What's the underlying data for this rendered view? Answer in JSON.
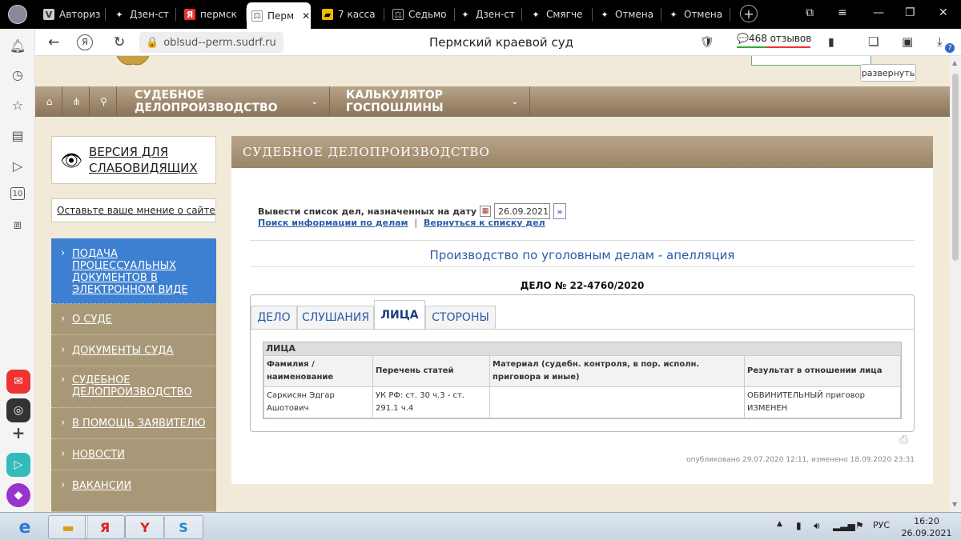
{
  "browser": {
    "tabs": [
      {
        "label": "Авториз",
        "icon": "vk"
      },
      {
        "label": "Дзен-ст",
        "icon": "dzen"
      },
      {
        "label": "пермск",
        "icon": "yandex"
      },
      {
        "label": "Перм",
        "icon": "court"
      },
      {
        "label": "7 касса",
        "icon": "flag"
      },
      {
        "label": "Седьмо",
        "icon": "court"
      },
      {
        "label": "Дзен-ст",
        "icon": "dzen"
      },
      {
        "label": "Смягче",
        "icon": "dzen"
      },
      {
        "label": "Отмена",
        "icon": "dzen"
      },
      {
        "label": "Отмена",
        "icon": "dzen"
      }
    ],
    "url": "oblsud--perm.sudrf.ru",
    "page_title": "Пермский краевой суд",
    "reviews": "468 отзывов",
    "badge_count": "7",
    "sidebar_badge": "10"
  },
  "site": {
    "expand_label": "развернуть",
    "nav": {
      "item1": "СУДЕБНОЕ ДЕЛОПРОИЗВОДСТВО",
      "item2": "КАЛЬКУЛЯТОР ГОСПОШЛИНЫ"
    },
    "vision": "ВЕРСИЯ ДЛЯ СЛАБОВИДЯЩИХ",
    "opinion": "Оставьте ваше мнение о сайте",
    "menu": [
      "ПОДАЧА ПРОЦЕССУАЛЬНЫХ ДОКУМЕНТОВ В ЭЛЕКТРОННОМ ВИДЕ",
      "О СУДЕ",
      "ДОКУМЕНТЫ СУДА",
      "СУДЕБНОЕ ДЕЛОПРОИЗВОДСТВО",
      "В ПОМОЩЬ ЗАЯВИТЕЛЮ",
      "НОВОСТИ",
      "ВАКАНСИИ"
    ]
  },
  "content": {
    "header": "СУДЕБНОЕ ДЕЛОПРОИЗВОДСТВО",
    "date_label": "Вывести список дел, назначенных на дату",
    "date_value": "26.09.2021",
    "link_search": "Поиск информации по делам",
    "link_sep": "|",
    "link_back": "Вернуться к списку дел",
    "title": "Производство по уголовным делам - апелляция",
    "case_number": "ДЕЛО № 22-4760/2020",
    "tabs": [
      "ДЕЛО",
      "СЛУШАНИЯ",
      "ЛИЦА",
      "СТОРОНЫ"
    ],
    "active_tab": "ЛИЦА",
    "table": {
      "caption": "ЛИЦА",
      "headers": [
        "Фамилия / наименование",
        "Перечень статей",
        "Материал (судебн. контроля, в пор. исполн. приговора и иные)",
        "Результат в отношении лица"
      ],
      "rows": [
        [
          "Саркисян Эдгар Ашотович",
          "УК РФ: ст. 30 ч.3 - ст. 291.1 ч.4",
          "",
          "ОБВИНИТЕЛЬНЫЙ приговор ИЗМЕНЕН"
        ]
      ]
    },
    "published": "опубликовано 29.07.2020 12:11, изменено 18.09.2020 23:31"
  },
  "taskbar": {
    "lang": "РУС",
    "time": "16:20",
    "date": "26.09.2021"
  },
  "colors": {
    "nav_brown": "#8a7358",
    "menu_tan": "#a89878",
    "menu_active": "#3d7fd0",
    "link_blue": "#2a5ba8",
    "page_bg": "#f2ead8"
  }
}
